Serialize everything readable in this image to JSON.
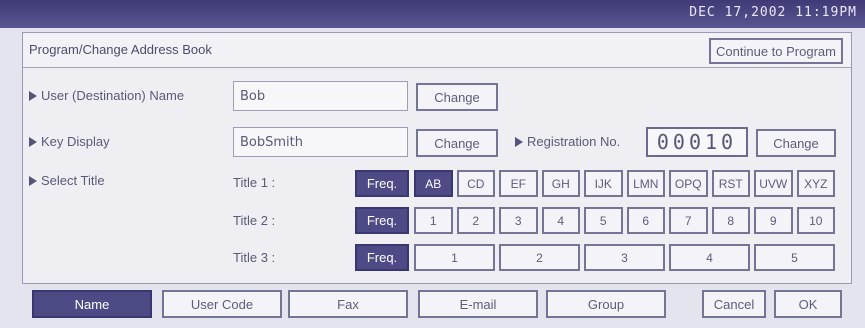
{
  "status": {
    "datetime": "DEC  17,2002 11:19PM"
  },
  "header": {
    "title": "Program/Change Address Book",
    "continue_label": "Continue to Program"
  },
  "user_name": {
    "label": "User (Destination) Name",
    "value": "Bob",
    "change_label": "Change"
  },
  "key_display": {
    "label": "Key Display",
    "value": "BobSmith",
    "change_label": "Change"
  },
  "registration": {
    "label": "Registration No.",
    "value": "00010",
    "change_label": "Change"
  },
  "select_title": {
    "label": "Select Title",
    "title1_label": "Title 1 :",
    "title2_label": "Title 2 :",
    "title3_label": "Title 3 :",
    "freq_label": "Freq.",
    "title1_keys": [
      "AB",
      "CD",
      "EF",
      "GH",
      "IJK",
      "LMN",
      "OPQ",
      "RST",
      "UVW",
      "XYZ"
    ],
    "title2_keys": [
      "1",
      "2",
      "3",
      "4",
      "5",
      "6",
      "7",
      "8",
      "9",
      "10"
    ],
    "title3_keys": [
      "1",
      "2",
      "3",
      "4",
      "5"
    ],
    "title1_selected": "AB"
  },
  "tabs": {
    "name": "Name",
    "user_code": "User Code",
    "fax": "Fax",
    "email": "E-mail",
    "group": "Group",
    "selected": "Name"
  },
  "actions": {
    "cancel": "Cancel",
    "ok": "OK"
  },
  "colors": {
    "selected_bg": "#4d4a86",
    "topbar_bg": "#3e3a76",
    "panel_bg": "#efeff3",
    "border": "#747495"
  }
}
